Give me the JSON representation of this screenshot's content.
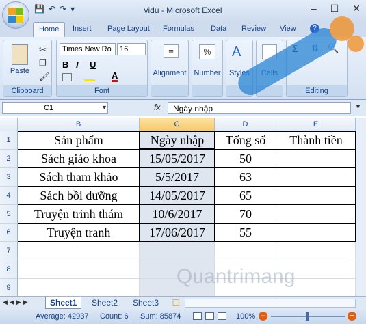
{
  "window": {
    "title": "vidu - Microsoft Excel"
  },
  "tabs": [
    "Home",
    "Insert",
    "Page Layout",
    "Formulas",
    "Data",
    "Review",
    "View"
  ],
  "ribbon": {
    "clipboard": {
      "label": "Clipboard",
      "paste": "Paste"
    },
    "font": {
      "label": "Font",
      "family": "Times New Ro",
      "size": "16",
      "bold": "B",
      "italic": "I",
      "underline": "U"
    },
    "alignment": {
      "label": "Alignment"
    },
    "number": {
      "label": "Number",
      "percent": "%"
    },
    "styles": {
      "label": "Styles"
    },
    "cells": {
      "label": "Cells"
    },
    "editing": {
      "label": "Editing",
      "sum": "Σ"
    }
  },
  "formula_bar": {
    "name_box": "C1",
    "fx": "fx",
    "formula": "Ngày nhập"
  },
  "columns": [
    "B",
    "C",
    "D",
    "E"
  ],
  "rows": [
    "1",
    "2",
    "3",
    "4",
    "5",
    "6",
    "7",
    "8",
    "9"
  ],
  "table": {
    "headers": [
      "Sản phẩm",
      "Ngày nhập",
      "Tổng số",
      "Thành tiền"
    ],
    "rows": [
      [
        "Sách giáo khoa",
        "15/05/2017",
        "50",
        ""
      ],
      [
        "Sách tham khảo",
        "5/5/2017",
        "63",
        ""
      ],
      [
        "Sách bồi dưỡng",
        "14/05/2017",
        "65",
        ""
      ],
      [
        "Truyện trinh thám",
        "10/6/2017",
        "70",
        ""
      ],
      [
        "Truyện tranh",
        "17/06/2017",
        "55",
        ""
      ]
    ]
  },
  "sheets": [
    "Sheet1",
    "Sheet2",
    "Sheet3"
  ],
  "status": {
    "average": "Average: 42937",
    "count": "Count: 6",
    "sum": "Sum: 85874",
    "zoom": "100%"
  },
  "watermark": {
    "brand": "Quantrimang"
  },
  "colors": {
    "accent": "#15428b",
    "selection": "#f8c96a",
    "ribbon": "#dfe8f5"
  }
}
